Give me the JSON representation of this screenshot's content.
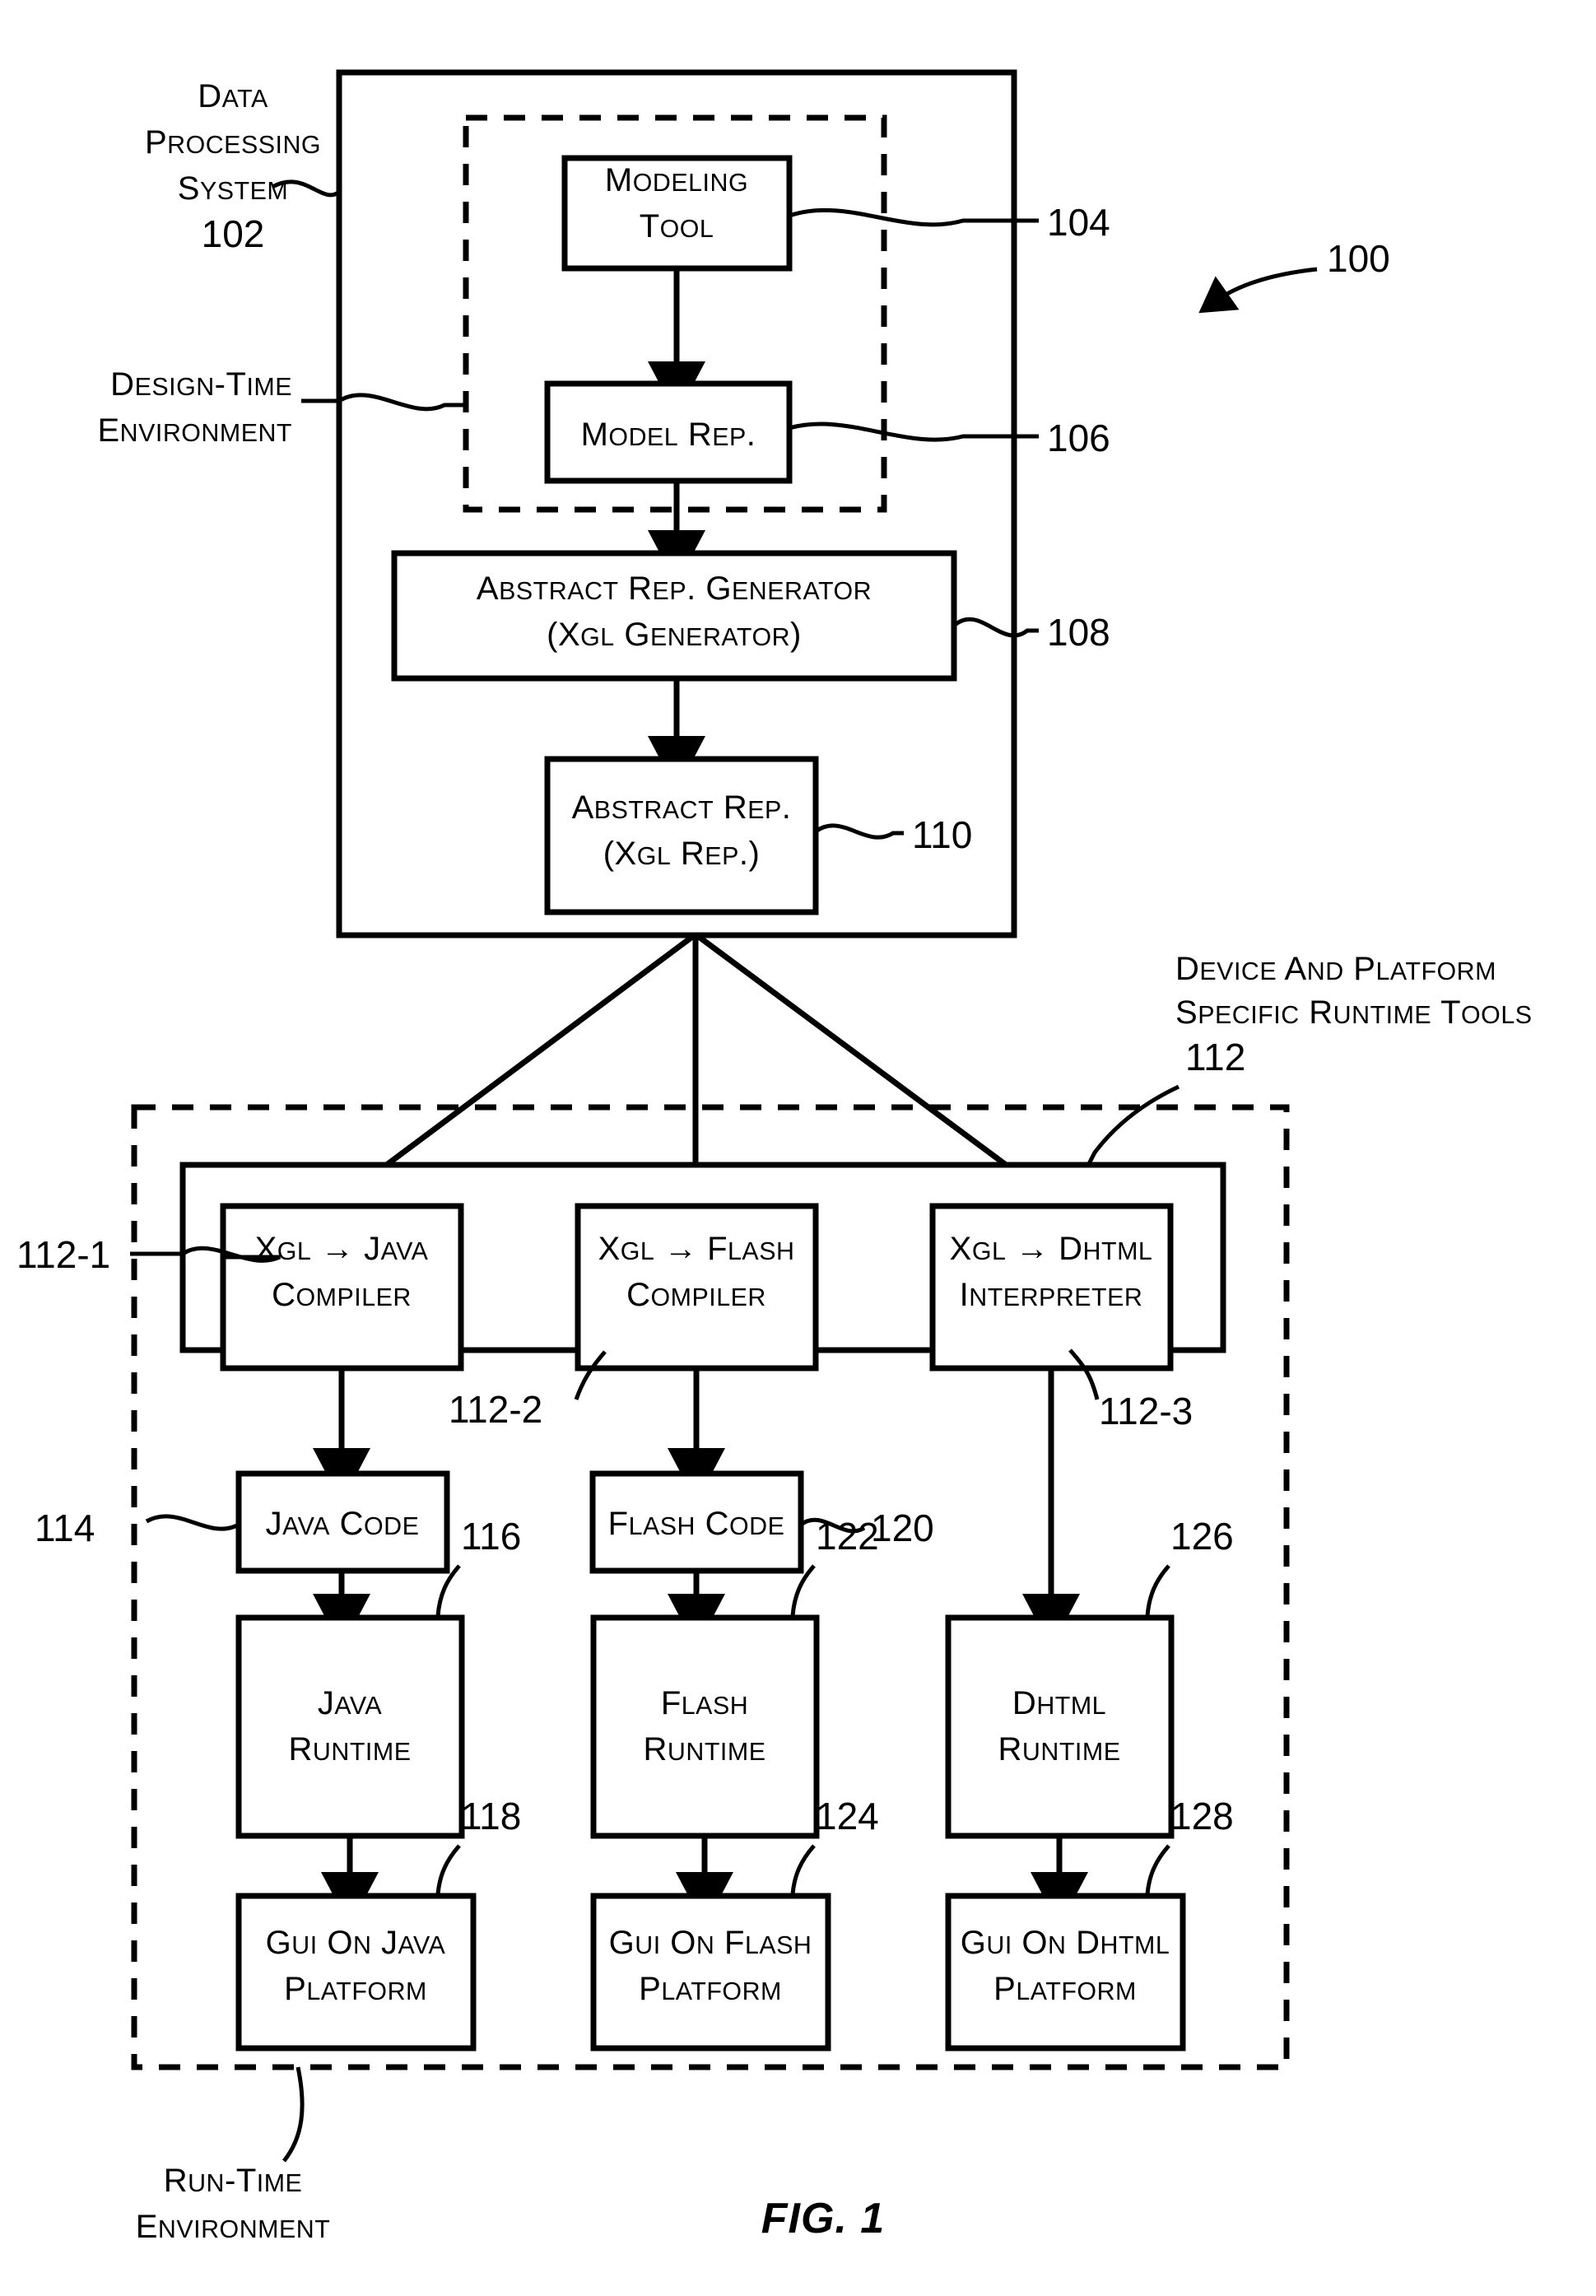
{
  "figure": {
    "caption": "FIG. 1",
    "overall_ref": "100"
  },
  "labels": {
    "data_processing_system": {
      "line1": "DATA",
      "line2": "PROCESSING",
      "line3": "SYSTEM",
      "ref": "102"
    },
    "design_time_environment": {
      "line1": "DESIGN-TIME",
      "line2": "ENVIRONMENT"
    },
    "runtime_tools": {
      "line1": "DEVICE AND PLATFORM",
      "line2": "SPECIFIC RUNTIME TOOLS",
      "ref": "112"
    },
    "run_time_environment": {
      "line1": "RUN-TIME",
      "line2": "ENVIRONMENT"
    }
  },
  "boxes": {
    "modeling_tool": {
      "line1": "MODELING",
      "line2": "TOOL",
      "ref": "104"
    },
    "model_rep": {
      "line1": "MODEL REP.",
      "line2": "",
      "ref": "106"
    },
    "abstract_rep_generator": {
      "line1": "ABSTRACT REP. GENERATOR",
      "line2": "(XGL GENERATOR)",
      "ref": "108"
    },
    "abstract_rep": {
      "line1": "ABSTRACT REP.",
      "line2": "(XGL REP.)",
      "ref": "110"
    },
    "xgl_java_compiler": {
      "line1": "XGL → JAVA",
      "line2": "COMPILER",
      "ref": "112-1"
    },
    "xgl_flash_compiler": {
      "line1": "XGL → FLASH",
      "line2": "COMPILER",
      "ref": "112-2"
    },
    "xgl_dhtml_interpreter": {
      "line1": "XGL → DHTML",
      "line2": "INTERPRETER",
      "ref": "112-3"
    },
    "java_code": {
      "line1": "JAVA CODE",
      "line2": "",
      "ref": "114"
    },
    "flash_code": {
      "line1": "FLASH CODE",
      "line2": "",
      "ref": "120"
    },
    "java_runtime": {
      "line1": "JAVA",
      "line2": "RUNTIME",
      "ref": "116"
    },
    "flash_runtime": {
      "line1": "FLASH",
      "line2": "RUNTIME",
      "ref": "122"
    },
    "dhtml_runtime": {
      "line1": "DHTML",
      "line2": "RUNTIME",
      "ref": "126"
    },
    "gui_java": {
      "line1": "GUI ON JAVA",
      "line2": "PLATFORM",
      "ref": "118"
    },
    "gui_flash": {
      "line1": "GUI ON FLASH",
      "line2": "PLATFORM",
      "ref": "124"
    },
    "gui_dhtml": {
      "line1": "GUI ON DHTML",
      "line2": "PLATFORM",
      "ref": "128"
    }
  },
  "colors": {
    "ink": "#000000",
    "paper": "#ffffff"
  }
}
